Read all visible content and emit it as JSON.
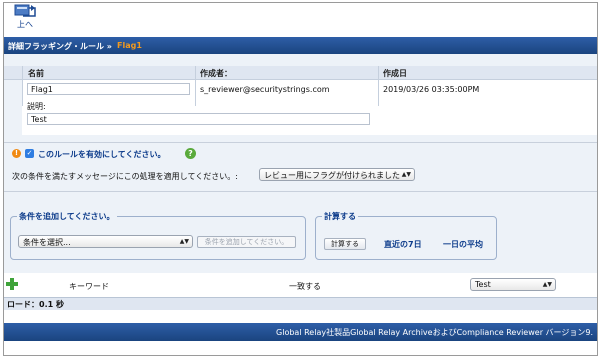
{
  "toolbar": {
    "up_label": "上へ"
  },
  "titlebar": {
    "crumb": "詳細フラッギング・ルール »",
    "current": "Flag1"
  },
  "rule_table": {
    "col_name": "名前",
    "col_author": "作成者：",
    "col_created": "作成日",
    "name_value": "Flag1",
    "author": "s_reviewer@securitystrings.com",
    "created": "2019/03/26 03:35:00PM",
    "desc_label": "説明:",
    "desc_value": "Test"
  },
  "enable": {
    "label": "このルールを有効にしてください。",
    "checked": true
  },
  "action": {
    "label": "次の条件を満たすメッセージにこの処理を適用してください。:",
    "selected": "レビュー用にフラグが付けられました"
  },
  "conditions": {
    "legend": "条件を追加してください。",
    "select_value": "条件を選択...",
    "add_placeholder": "条件を追加してください。"
  },
  "calculate": {
    "legend": "計算する",
    "button": "計算する",
    "recent7": "直近の7日",
    "daily_avg": "一日の平均"
  },
  "keyword_row": {
    "keyword": "キーワード",
    "match": "一致する",
    "select_value": "Test"
  },
  "status": {
    "load": "ロード：0.1 秒"
  },
  "footer": {
    "text": "Global Relay社製品Global Relay ArchiveおよびCompliance Reviewer バージョン9."
  },
  "colors": {
    "header_blue": "#1a447f",
    "accent_orange": "#f39a1e",
    "link_blue": "#0b3a8a"
  }
}
